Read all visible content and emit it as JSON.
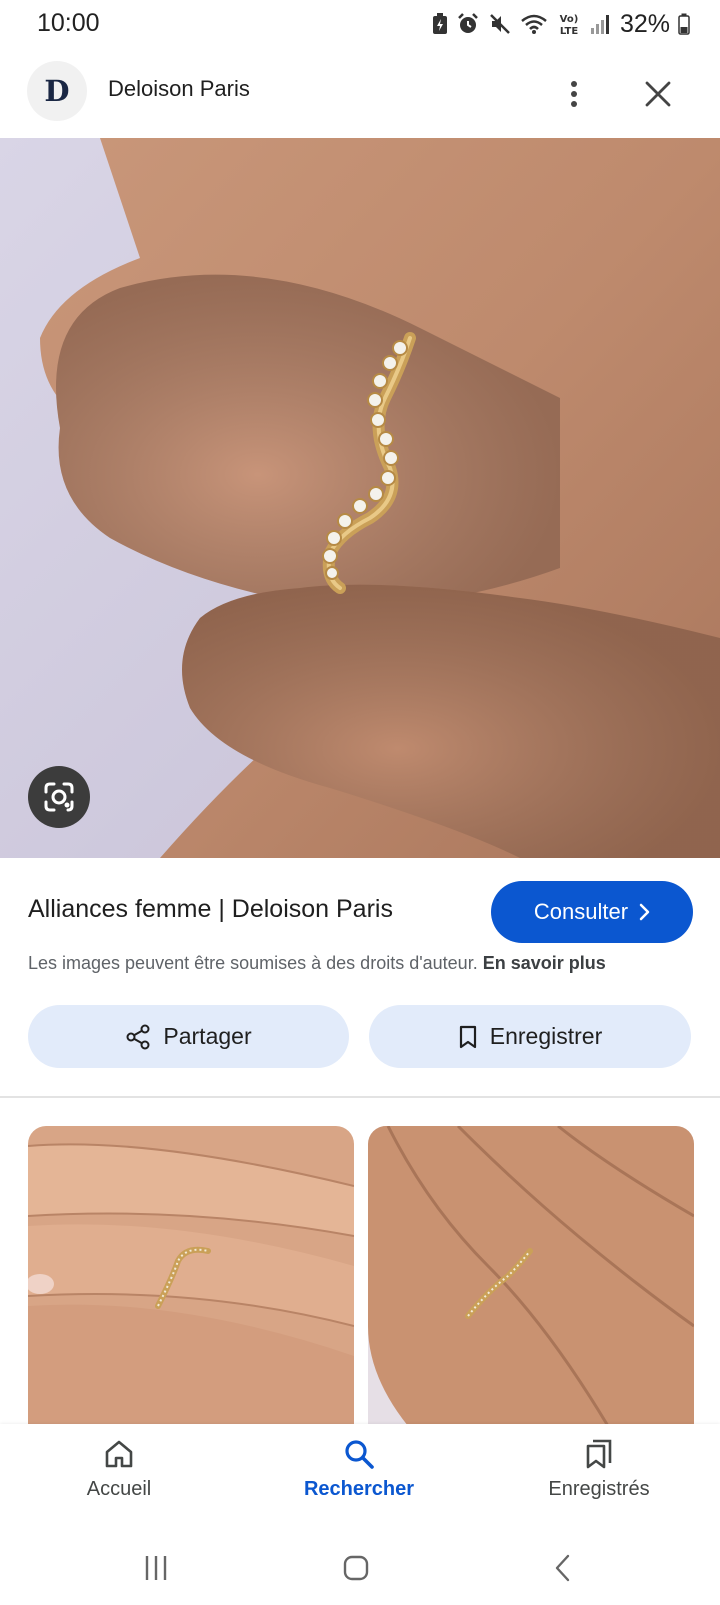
{
  "status_bar": {
    "time": "10:00",
    "battery": "32%",
    "icons": [
      "battery-saver-icon",
      "alarm-icon",
      "mute-icon",
      "wifi-icon",
      "volte-icon",
      "signal-icon",
      "battery-icon"
    ]
  },
  "header": {
    "logo_letter": "D",
    "site_name": "Deloison Paris",
    "icons": [
      "more-vert-icon",
      "close-icon"
    ]
  },
  "result": {
    "title": "Alliances femme | Deloison Paris",
    "visit_label": "Consulter",
    "copyright_notice": "Les images peuvent être soumises à des droits d'auteur.",
    "learn_more": "En savoir plus"
  },
  "actions": {
    "share_label": "Partager",
    "save_label": "Enregistrer"
  },
  "bottom_nav": {
    "items": [
      {
        "label": "Accueil",
        "icon": "home-icon"
      },
      {
        "label": "Rechercher",
        "icon": "search-icon",
        "active": true
      },
      {
        "label": "Enregistrés",
        "icon": "collections-icon"
      }
    ]
  },
  "colors": {
    "accent": "#0b57d0",
    "action_button_bg": "#e2ebfa"
  }
}
